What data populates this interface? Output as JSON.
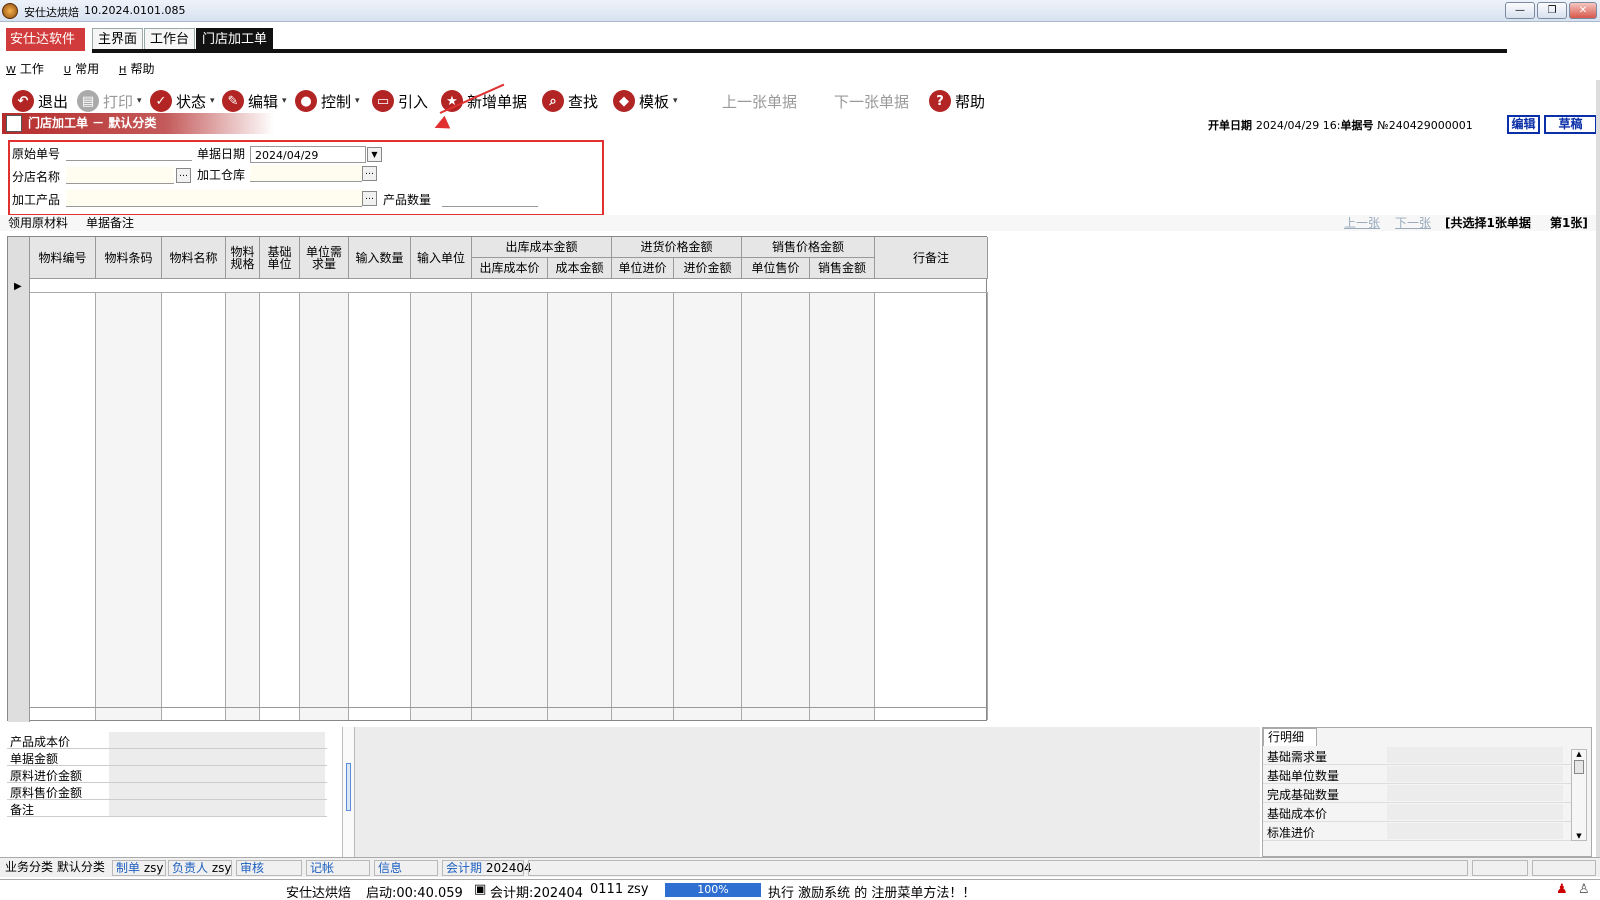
{
  "window": {
    "title": "安仕达烘焙",
    "version": "10.2024.0101.085",
    "controls": [
      "—",
      "❐",
      "✕"
    ]
  },
  "brand": "安仕达软件",
  "tabs": [
    "主界面",
    "工作台",
    "门店加工单"
  ],
  "menu": [
    {
      "key": "W",
      "label": "工作"
    },
    {
      "key": "U",
      "label": "常用"
    },
    {
      "key": "H",
      "label": "帮助"
    }
  ],
  "toolbar": {
    "exit": "退出",
    "print": "打印",
    "status": "状态",
    "edit": "编辑",
    "control": "控制",
    "import": "引入",
    "new": "新增单据",
    "find": "查找",
    "template": "模板",
    "prev": "上一张单据",
    "next": "下一张单据",
    "help": "帮助"
  },
  "doc": {
    "title": "门店加工单 － 默认分类",
    "open_date_label": "开单日期",
    "open_date": "2024/04/29 16:",
    "doc_no_label": "单据号",
    "doc_no": "№240429000001",
    "btn_edit": "编辑",
    "btn_draft": "草稿"
  },
  "form": {
    "orig_no_label": "原始单号",
    "orig_no": "",
    "date_label": "单据日期",
    "date_value": "2024/04/29",
    "branch_label": "分店名称",
    "branch": "",
    "warehouse_label": "加工仓库",
    "warehouse": "",
    "product_label": "加工产品",
    "product": "",
    "qty_label": "产品数量",
    "qty": ""
  },
  "subtabs": [
    "领用原材料",
    "单据备注"
  ],
  "nav": {
    "prev": "上一张",
    "next": "下一张",
    "summary": "[共选择1张单据",
    "page": "第1张]"
  },
  "grid": {
    "columns": [
      "物料编号",
      "物料条码",
      "物料名称",
      "物料规格",
      "基础单位",
      "单位需求量",
      "输入数量",
      "输入单位",
      "行备注"
    ],
    "groups": [
      {
        "title": "出库成本金额",
        "sub": [
          "出库成本价",
          "成本金额"
        ]
      },
      {
        "title": "进货价格金额",
        "sub": [
          "单位进价",
          "进价金额"
        ]
      },
      {
        "title": "销售价格金额",
        "sub": [
          "单位售价",
          "销售金额"
        ]
      }
    ]
  },
  "footer": [
    "产品成本价",
    "单据金额",
    "原料进价金额",
    "原料售价金额",
    "备注"
  ],
  "detail": {
    "tab": "行明细",
    "rows": [
      "基础需求量",
      "基础单位数量",
      "完成基础数量",
      "基础成本价",
      "标准进价"
    ]
  },
  "status1": {
    "category_label": "业务分类",
    "category": "默认分类",
    "maker_label": "制单",
    "maker": "zsy",
    "owner_label": "负责人",
    "owner": "zsy",
    "audit_label": "审核",
    "post_label": "记帐",
    "info_label": "信息",
    "period_label": "会计期",
    "period": "202404"
  },
  "status2": {
    "company": "安仕达烘焙",
    "startup": "启动:00:40.059",
    "period": "会计期:202404",
    "user": "0111 zsy",
    "progress": "100%",
    "progress_value": 1.0,
    "message": "执行 激励系统 的 注册菜单方法！！"
  },
  "colors": {
    "accent": "#d23b3b",
    "highlight": "#e03030",
    "link": "#1d5fbf",
    "progress": "#2f6fd2"
  }
}
